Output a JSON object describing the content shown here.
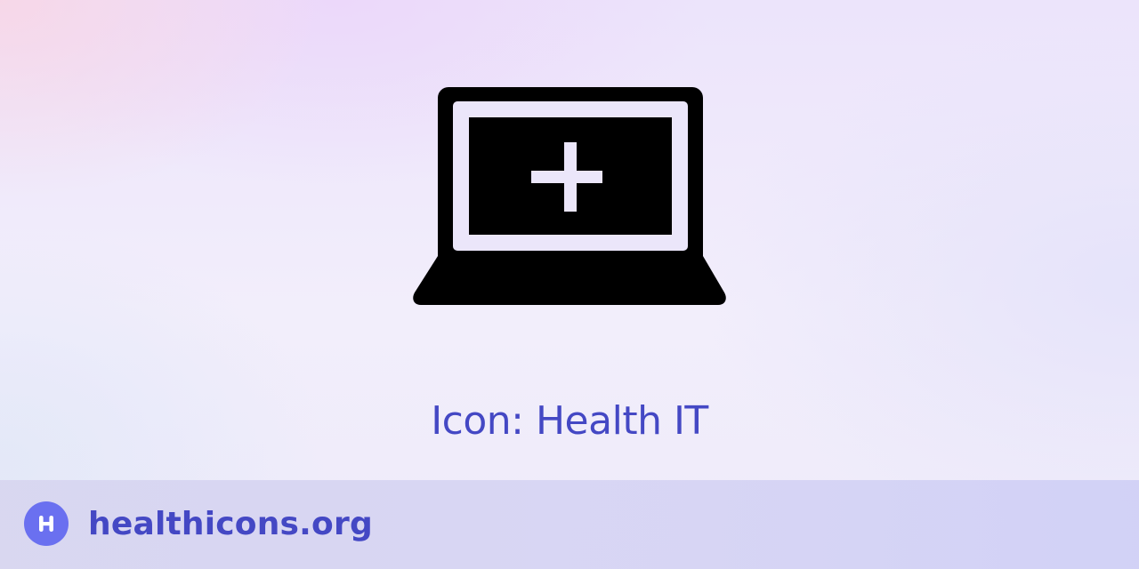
{
  "hero": {
    "icon": "laptop-medical-cross-icon",
    "title": "Icon: Health IT"
  },
  "footer": {
    "logo_letter": "H",
    "site": "healthicons.org"
  },
  "colors": {
    "icon": "#000000",
    "title": "#4448c4",
    "logo_background": "#6a70f0",
    "footer_text": "#4448c4"
  }
}
